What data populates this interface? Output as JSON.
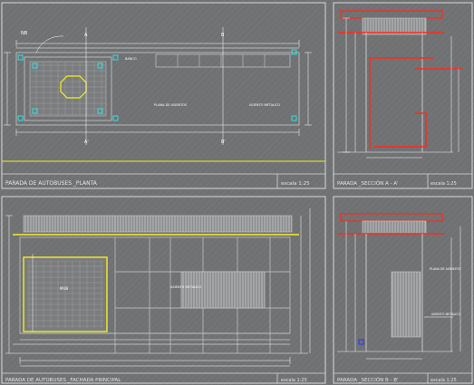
{
  "colors": {
    "background": "#6f7173",
    "hatch": "#7c7e80",
    "frame": "#d9d9d9",
    "line": "#c8c8c8",
    "dim": "#ffffff",
    "accent_red": "#ff2a1a",
    "accent_yellow": "#f5f021",
    "accent_cyan": "#33e0e0",
    "accent_blue": "#3030ff"
  },
  "panels": {
    "planta": {
      "title": "PARADA DE AUTOBUSES _PLANTA",
      "scale": "escala 1:25",
      "labels": {
        "nb": "NB",
        "leyenda_a": "A",
        "leyenda_a2": "A'",
        "leyenda_b": "B",
        "leyenda_b2": "B'",
        "banco": "BANCO",
        "plana": "PLANA DE ASIENTOS",
        "asiento": "ASIENTO METALICO"
      }
    },
    "seccion_a": {
      "title": "PARADA _SECCIÓN A - A'",
      "scale": "escala 1:25"
    },
    "fachada": {
      "title": "PARADA DE AUTOBUSES _FACHADA PRINCIPAL",
      "scale": "escala 1:25",
      "labels": {
        "anuncio": "MUB",
        "asiento": "ASIENTO METALICO"
      }
    },
    "seccion_b": {
      "title": "PARADA _SECCIÓN B - B'",
      "scale": "escala 1:25",
      "labels": {
        "plana": "PLANA DE ASIENTOS",
        "asiento": "ASIENTO METALICO"
      }
    }
  }
}
